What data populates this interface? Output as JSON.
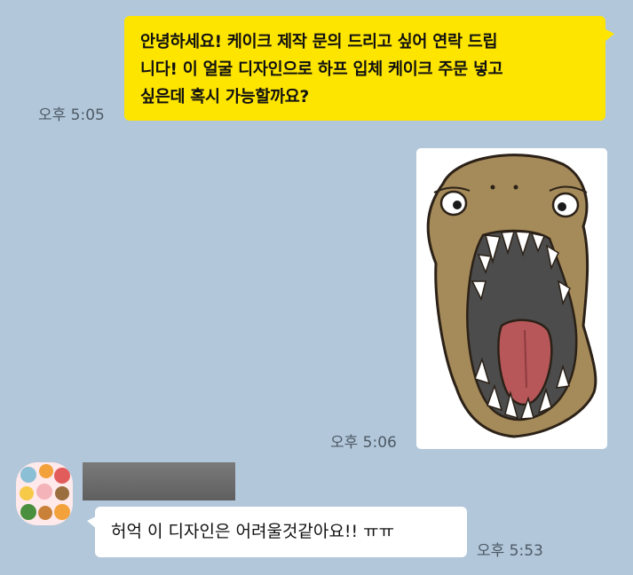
{
  "messages": {
    "outgoing_text": {
      "line1": "안녕하세요! 케이크 제작 문의 드리고 싶어 연락 드립",
      "line2": "니다! 이 얼굴 디자인으로 하프 입체 케이크 주문 넣고",
      "line3": "싶은데 혹시 가능할까요?",
      "time": "오후 5:05"
    },
    "outgoing_image": {
      "time": "오후 5:06"
    },
    "incoming_text": {
      "text": "허억 이 디자인은 어려울것같아요!! ㅠㅠ",
      "time": "오후 5:53"
    }
  },
  "colors": {
    "background": "#b2c7da",
    "outgoing_bubble": "#fee500",
    "incoming_bubble": "#ffffff"
  }
}
